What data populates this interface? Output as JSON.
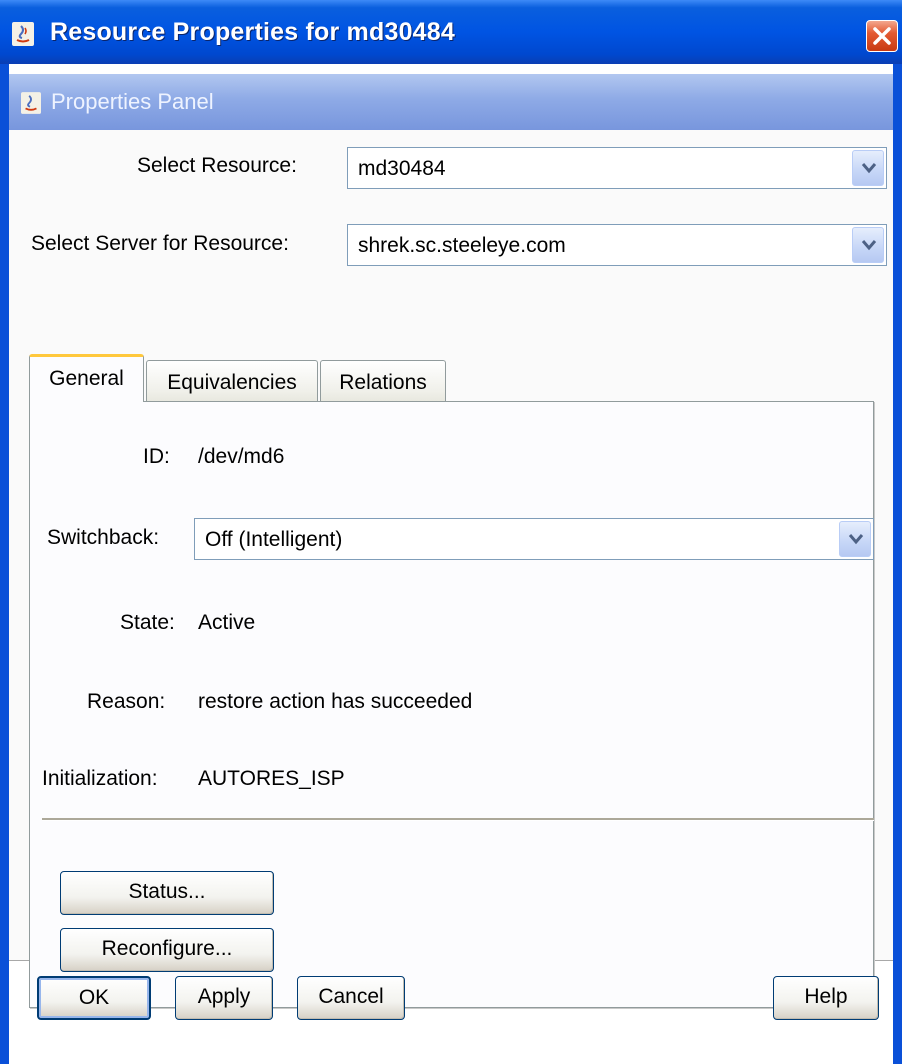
{
  "window": {
    "title": "Resource Properties for md30484",
    "icon": "java-icon"
  },
  "panel": {
    "title": "Properties Panel",
    "icon": "java-icon"
  },
  "selectors": {
    "resource_label": "Select Resource:",
    "resource_value": "md30484",
    "server_label": "Select Server for Resource:",
    "server_value": "shrek.sc.steeleye.com"
  },
  "tabs": [
    {
      "label": "General",
      "active": true
    },
    {
      "label": "Equivalencies",
      "active": false
    },
    {
      "label": "Relations",
      "active": false
    }
  ],
  "general": {
    "id_label": "ID:",
    "id_value": "/dev/md6",
    "switchback_label": "Switchback:",
    "switchback_value": "Off (Intelligent)",
    "state_label": "State:",
    "state_value": "Active",
    "reason_label": "Reason:",
    "reason_value": "restore action has succeeded",
    "init_label": "Initialization:",
    "init_value": "AUTORES_ISP",
    "status_button": "Status...",
    "reconfigure_button": "Reconfigure..."
  },
  "footer": {
    "ok": "OK",
    "apply": "Apply",
    "cancel": "Cancel",
    "help": "Help"
  },
  "colors": {
    "titlebar": "#0054e3",
    "panel_header": "#8eaae6",
    "close_button": "#e45a32",
    "active_tab_accent": "#ffc83c"
  }
}
